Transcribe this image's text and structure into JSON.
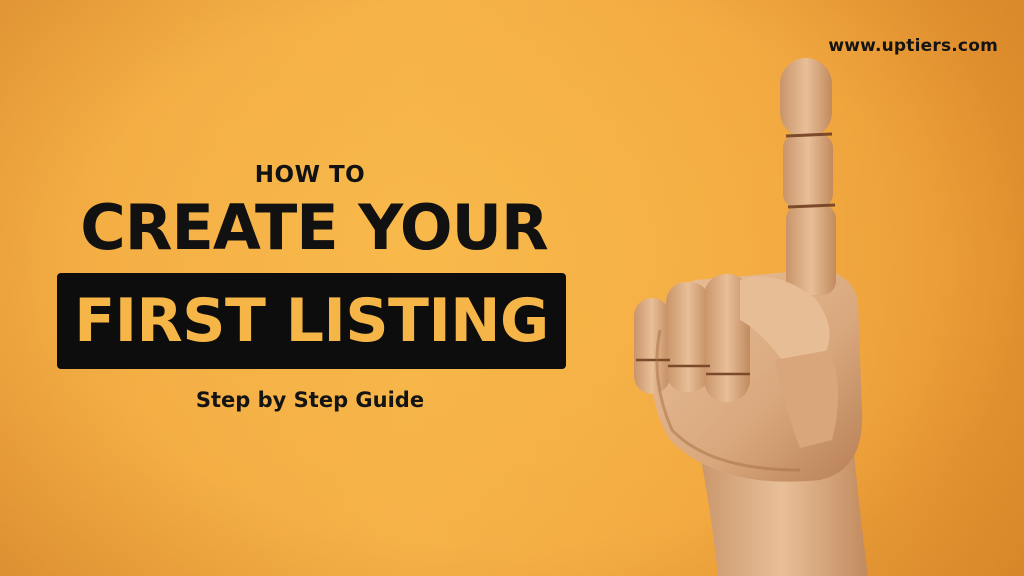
{
  "site": {
    "url": "www.uptiers.com"
  },
  "headline": {
    "kicker": "HOW TO",
    "line1": "CREATE YOUR",
    "line2": "FIRST LISTING",
    "subtitle": "Step by Step Guide"
  },
  "illustration": {
    "subject": "wooden-hand-pointing-up-icon"
  },
  "colors": {
    "background": "#f2a83f",
    "text_dark": "#111111",
    "highlight_box": "#0d0d0d",
    "highlight_text": "#f6b547",
    "wood": "#e2b48a"
  }
}
